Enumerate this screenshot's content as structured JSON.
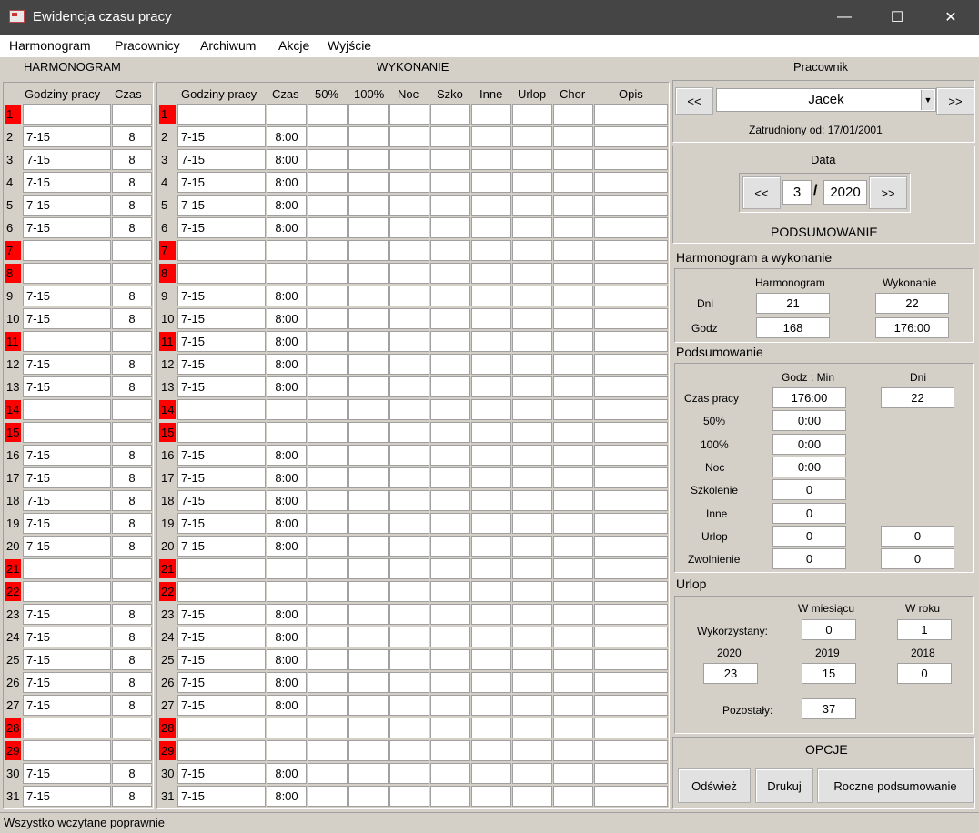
{
  "window": {
    "title": "Ewidencja czasu pracy",
    "minimize": "—",
    "maximize": "☐",
    "close": "✕"
  },
  "menu": [
    "Harmonogram",
    "Pracownicy",
    "Archiwum",
    "Akcje",
    "Wyjście"
  ],
  "harmonogram": {
    "header": "HARMONOGRAM",
    "col_hours": "Godziny pracy",
    "col_time": "Czas"
  },
  "wykonanie": {
    "header": "WYKONANIE",
    "cols": [
      "Godziny pracy",
      "Czas",
      "50%",
      "100%",
      "Noc",
      "Szko",
      "Inne",
      "Urlop",
      "Chor",
      "Opis"
    ]
  },
  "days": [
    {
      "d": "1",
      "red": true,
      "h": "",
      "t": "",
      "wh": "",
      "wt": ""
    },
    {
      "d": "2",
      "red": false,
      "h": "7-15",
      "t": "8",
      "wh": "7-15",
      "wt": "8:00"
    },
    {
      "d": "3",
      "red": false,
      "h": "7-15",
      "t": "8",
      "wh": "7-15",
      "wt": "8:00"
    },
    {
      "d": "4",
      "red": false,
      "h": "7-15",
      "t": "8",
      "wh": "7-15",
      "wt": "8:00"
    },
    {
      "d": "5",
      "red": false,
      "h": "7-15",
      "t": "8",
      "wh": "7-15",
      "wt": "8:00"
    },
    {
      "d": "6",
      "red": false,
      "h": "7-15",
      "t": "8",
      "wh": "7-15",
      "wt": "8:00"
    },
    {
      "d": "7",
      "red": true,
      "h": "",
      "t": "",
      "wh": "",
      "wt": ""
    },
    {
      "d": "8",
      "red": true,
      "h": "",
      "t": "",
      "wh": "",
      "wt": ""
    },
    {
      "d": "9",
      "red": false,
      "h": "7-15",
      "t": "8",
      "wh": "7-15",
      "wt": "8:00"
    },
    {
      "d": "10",
      "red": false,
      "h": "7-15",
      "t": "8",
      "wh": "7-15",
      "wt": "8:00"
    },
    {
      "d": "11",
      "red": true,
      "h": "",
      "t": "",
      "wh": "7-15",
      "wt": "8:00"
    },
    {
      "d": "12",
      "red": false,
      "h": "7-15",
      "t": "8",
      "wh": "7-15",
      "wt": "8:00"
    },
    {
      "d": "13",
      "red": false,
      "h": "7-15",
      "t": "8",
      "wh": "7-15",
      "wt": "8:00"
    },
    {
      "d": "14",
      "red": true,
      "h": "",
      "t": "",
      "wh": "",
      "wt": ""
    },
    {
      "d": "15",
      "red": true,
      "h": "",
      "t": "",
      "wh": "",
      "wt": ""
    },
    {
      "d": "16",
      "red": false,
      "h": "7-15",
      "t": "8",
      "wh": "7-15",
      "wt": "8:00"
    },
    {
      "d": "17",
      "red": false,
      "h": "7-15",
      "t": "8",
      "wh": "7-15",
      "wt": "8:00"
    },
    {
      "d": "18",
      "red": false,
      "h": "7-15",
      "t": "8",
      "wh": "7-15",
      "wt": "8:00"
    },
    {
      "d": "19",
      "red": false,
      "h": "7-15",
      "t": "8",
      "wh": "7-15",
      "wt": "8:00"
    },
    {
      "d": "20",
      "red": false,
      "h": "7-15",
      "t": "8",
      "wh": "7-15",
      "wt": "8:00"
    },
    {
      "d": "21",
      "red": true,
      "h": "",
      "t": "",
      "wh": "",
      "wt": ""
    },
    {
      "d": "22",
      "red": true,
      "h": "",
      "t": "",
      "wh": "",
      "wt": ""
    },
    {
      "d": "23",
      "red": false,
      "h": "7-15",
      "t": "8",
      "wh": "7-15",
      "wt": "8:00"
    },
    {
      "d": "24",
      "red": false,
      "h": "7-15",
      "t": "8",
      "wh": "7-15",
      "wt": "8:00"
    },
    {
      "d": "25",
      "red": false,
      "h": "7-15",
      "t": "8",
      "wh": "7-15",
      "wt": "8:00"
    },
    {
      "d": "26",
      "red": false,
      "h": "7-15",
      "t": "8",
      "wh": "7-15",
      "wt": "8:00"
    },
    {
      "d": "27",
      "red": false,
      "h": "7-15",
      "t": "8",
      "wh": "7-15",
      "wt": "8:00"
    },
    {
      "d": "28",
      "red": true,
      "h": "",
      "t": "",
      "wh": "",
      "wt": ""
    },
    {
      "d": "29",
      "red": true,
      "h": "",
      "t": "",
      "wh": "",
      "wt": ""
    },
    {
      "d": "30",
      "red": false,
      "h": "7-15",
      "t": "8",
      "wh": "7-15",
      "wt": "8:00"
    },
    {
      "d": "31",
      "red": false,
      "h": "7-15",
      "t": "8",
      "wh": "7-15",
      "wt": "8:00"
    }
  ],
  "pracownik": {
    "header": "Pracownik",
    "prev": "<<",
    "next": ">>",
    "name": "Jacek",
    "employed": "Zatrudniony od: 17/01/2001"
  },
  "data": {
    "header": "Data",
    "prev": "<<",
    "next": ">>",
    "month": "3",
    "sep": "/",
    "year": "2020"
  },
  "podsumowanie_header": "PODSUMOWANIE",
  "hw": {
    "title": "Harmonogram a wykonanie",
    "col_h": "Harmonogram",
    "col_w": "Wykonanie",
    "dni": "Dni",
    "godz": "Godz",
    "h_dni": "21",
    "w_dni": "22",
    "h_godz": "168",
    "w_godz": "176:00"
  },
  "sum": {
    "title": "Podsumowanie",
    "col_gm": "Godz : Min",
    "col_dni": "Dni",
    "rows": [
      {
        "label": "Czas pracy",
        "gm": "176:00",
        "dni": "22"
      },
      {
        "label": "50%",
        "gm": "0:00",
        "dni": null
      },
      {
        "label": "100%",
        "gm": "0:00",
        "dni": null
      },
      {
        "label": "Noc",
        "gm": "0:00",
        "dni": null
      },
      {
        "label": "Szkolenie",
        "gm": "0",
        "dni": null
      },
      {
        "label": "Inne",
        "gm": "0",
        "dni": null
      },
      {
        "label": "Urlop",
        "gm": "0",
        "dni": "0"
      },
      {
        "label": "Zwolnienie",
        "gm": "0",
        "dni": "0"
      }
    ]
  },
  "urlop": {
    "title": "Urlop",
    "col_m": "W miesiącu",
    "col_r": "W roku",
    "used_label": "Wykorzystany:",
    "used_m": "0",
    "used_r": "1",
    "years": [
      "2020",
      "2019",
      "2018"
    ],
    "year_vals": [
      "23",
      "15",
      "0"
    ],
    "left_label": "Pozostały:",
    "left_val": "37"
  },
  "opcje": {
    "header": "OPCJE",
    "refresh": "Odśwież",
    "print": "Drukuj",
    "yearly": "Roczne podsumowanie"
  },
  "status": "Wszystko wczytane poprawnie"
}
